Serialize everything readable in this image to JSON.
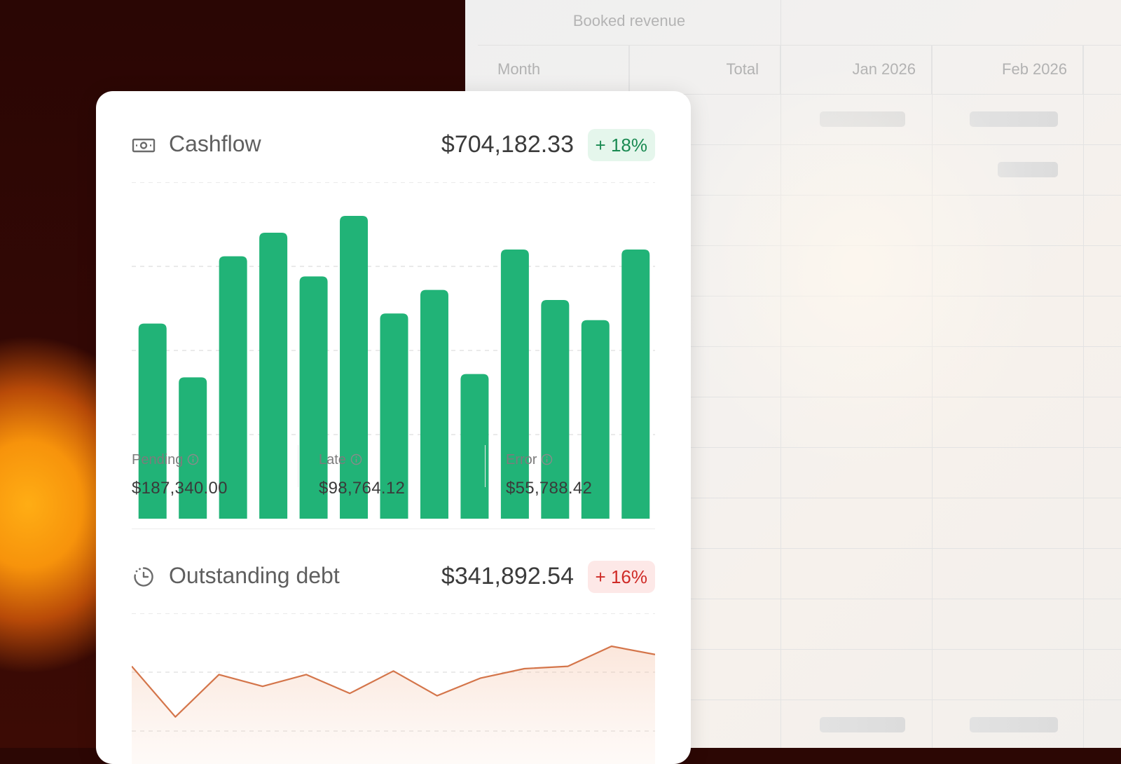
{
  "sheet": {
    "group_title": "Booked revenue",
    "columns": [
      "Month",
      "Total",
      "Jan 2026",
      "Feb 2026"
    ]
  },
  "cashflow": {
    "icon": "banknote-icon",
    "title": "Cashflow",
    "amount": "$704,182.33",
    "change": "+ 18%",
    "change_color": "#1a8a52",
    "bar_color": "#21b377",
    "stats": [
      {
        "label": "Pending",
        "value": "$187,340.00"
      },
      {
        "label": "Late",
        "value": "$98,764.12"
      },
      {
        "label": "Error",
        "value": "$55,788.42"
      }
    ]
  },
  "debt": {
    "icon": "clock-pie-icon",
    "title": "Outstanding debt",
    "amount": "$341,892.54",
    "change": "+ 16%",
    "change_color": "#cf2b27",
    "line_color": "#d4754a"
  },
  "chart_data": [
    {
      "type": "bar",
      "title": "",
      "values": [
        58,
        42,
        78,
        85,
        72,
        90,
        61,
        68,
        43,
        80,
        65,
        59,
        80
      ],
      "ylim": [
        0,
        100
      ],
      "grid": true
    },
    {
      "type": "area",
      "title": "",
      "values": [
        55,
        12,
        48,
        38,
        48,
        32,
        51,
        30,
        45,
        53,
        55,
        72,
        65
      ],
      "ylim": [
        0,
        100
      ],
      "grid": true
    }
  ]
}
